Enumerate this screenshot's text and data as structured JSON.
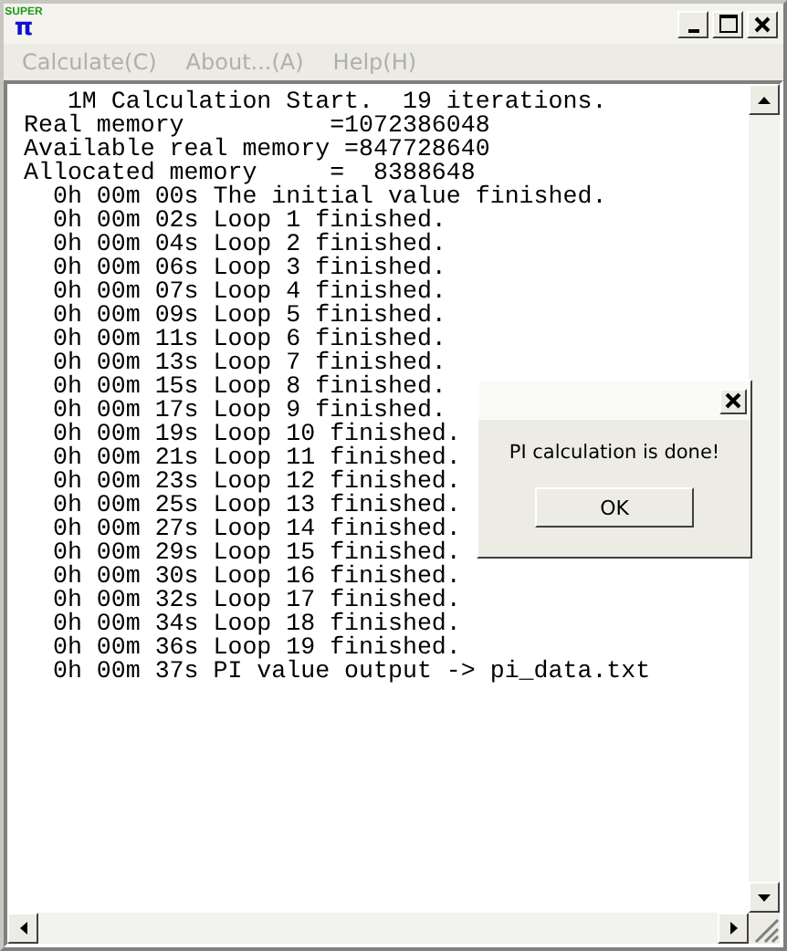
{
  "window": {
    "logo_top": "SUPER",
    "logo_bottom": "π"
  },
  "menu": [
    {
      "label": "Calculate(C)",
      "disabled": true
    },
    {
      "label": "About...(A)",
      "disabled": true
    },
    {
      "label": "Help(H)",
      "disabled": true
    }
  ],
  "console": {
    "lines": [
      "   1M Calculation Start.  19 iterations.",
      "Real memory          =1072386048",
      "Available real memory =847728640",
      "Allocated memory     =  8388648",
      "  0h 00m 00s The initial value finished.",
      "  0h 00m 02s Loop 1 finished.",
      "  0h 00m 04s Loop 2 finished.",
      "  0h 00m 06s Loop 3 finished.",
      "  0h 00m 07s Loop 4 finished.",
      "  0h 00m 09s Loop 5 finished.",
      "  0h 00m 11s Loop 6 finished.",
      "  0h 00m 13s Loop 7 finished.",
      "  0h 00m 15s Loop 8 finished.",
      "  0h 00m 17s Loop 9 finished.",
      "  0h 00m 19s Loop 10 finished.",
      "  0h 00m 21s Loop 11 finished.",
      "  0h 00m 23s Loop 12 finished.",
      "  0h 00m 25s Loop 13 finished.",
      "  0h 00m 27s Loop 14 finished.",
      "  0h 00m 29s Loop 15 finished.",
      "  0h 00m 30s Loop 16 finished.",
      "  0h 00m 32s Loop 17 finished.",
      "  0h 00m 34s Loop 18 finished.",
      "  0h 00m 36s Loop 19 finished.",
      "  0h 00m 37s PI value output -> pi_data.txt"
    ]
  },
  "dialog": {
    "message": "PI calculation is done!",
    "button": "OK"
  }
}
